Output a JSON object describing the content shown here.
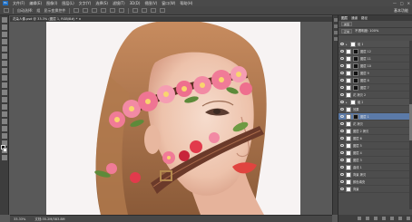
{
  "app": {
    "logo": "Ps"
  },
  "menu": [
    "文件(F)",
    "编辑(E)",
    "图像(I)",
    "图层(L)",
    "文字(Y)",
    "选择(S)",
    "滤镜(T)",
    "3D(D)",
    "视图(V)",
    "窗口(W)",
    "帮助(H)"
  ],
  "window_controls": [
    "—",
    "□",
    "✕"
  ],
  "options": {
    "auto_select_label": "自动选择:",
    "auto_select_value": "组",
    "transform_label": "显示变换控件",
    "workspace": "基本功能"
  },
  "document_tab": {
    "title": "花朵人像.psd @ 33.3% (图层 1, RGB/8#) *  ×"
  },
  "status": {
    "zoom": "33.33%",
    "doc_info": "文档:35.2M/383.8M"
  },
  "layers_panel": {
    "tabs": [
      "图层",
      "通道",
      "路径"
    ],
    "kind_label": "类型",
    "blend_mode": "正常",
    "opacity_label": "不透明度: 100%",
    "lock_label": "锁定:",
    "fill_label": "填充: 100%",
    "rows": [
      {
        "name": "组 1",
        "type": "group",
        "selected": false
      },
      {
        "name": "图层 12",
        "type": "mask",
        "selected": false
      },
      {
        "name": "图层 11",
        "type": "mask",
        "selected": false
      },
      {
        "name": "图层 10",
        "type": "mask",
        "selected": false
      },
      {
        "name": "图层 9",
        "type": "mask",
        "selected": false
      },
      {
        "name": "图层 8",
        "type": "mask",
        "selected": false
      },
      {
        "name": "图层 7",
        "type": "mask",
        "selected": false
      },
      {
        "name": "花 拷贝 2",
        "type": "layer",
        "selected": false
      },
      {
        "name": "组 2",
        "type": "group",
        "selected": false
      },
      {
        "name": "效果",
        "type": "layer",
        "selected": false
      },
      {
        "name": "图层 1",
        "type": "mask",
        "selected": true
      },
      {
        "name": "花 拷贝",
        "type": "layer",
        "selected": false
      },
      {
        "name": "图层 2 拷贝",
        "type": "layer",
        "selected": false
      },
      {
        "name": "图层 6",
        "type": "layer",
        "selected": false
      },
      {
        "name": "图层 5",
        "type": "layer",
        "selected": false
      },
      {
        "name": "图层 4",
        "type": "layer",
        "selected": false
      },
      {
        "name": "图层 3",
        "type": "layer",
        "selected": false
      },
      {
        "name": "曲线 1",
        "type": "layer",
        "selected": false
      },
      {
        "name": "背景 拷贝",
        "type": "layer",
        "selected": false
      },
      {
        "name": "颜色填充",
        "type": "layer",
        "selected": false
      },
      {
        "name": "背景",
        "type": "layer",
        "selected": false
      }
    ]
  },
  "colors": {
    "selection": "#5b7aa8",
    "panel_bg": "#4d4d4d",
    "canvas_bg": "#595959",
    "doc_bg": "#f7f3f3"
  }
}
